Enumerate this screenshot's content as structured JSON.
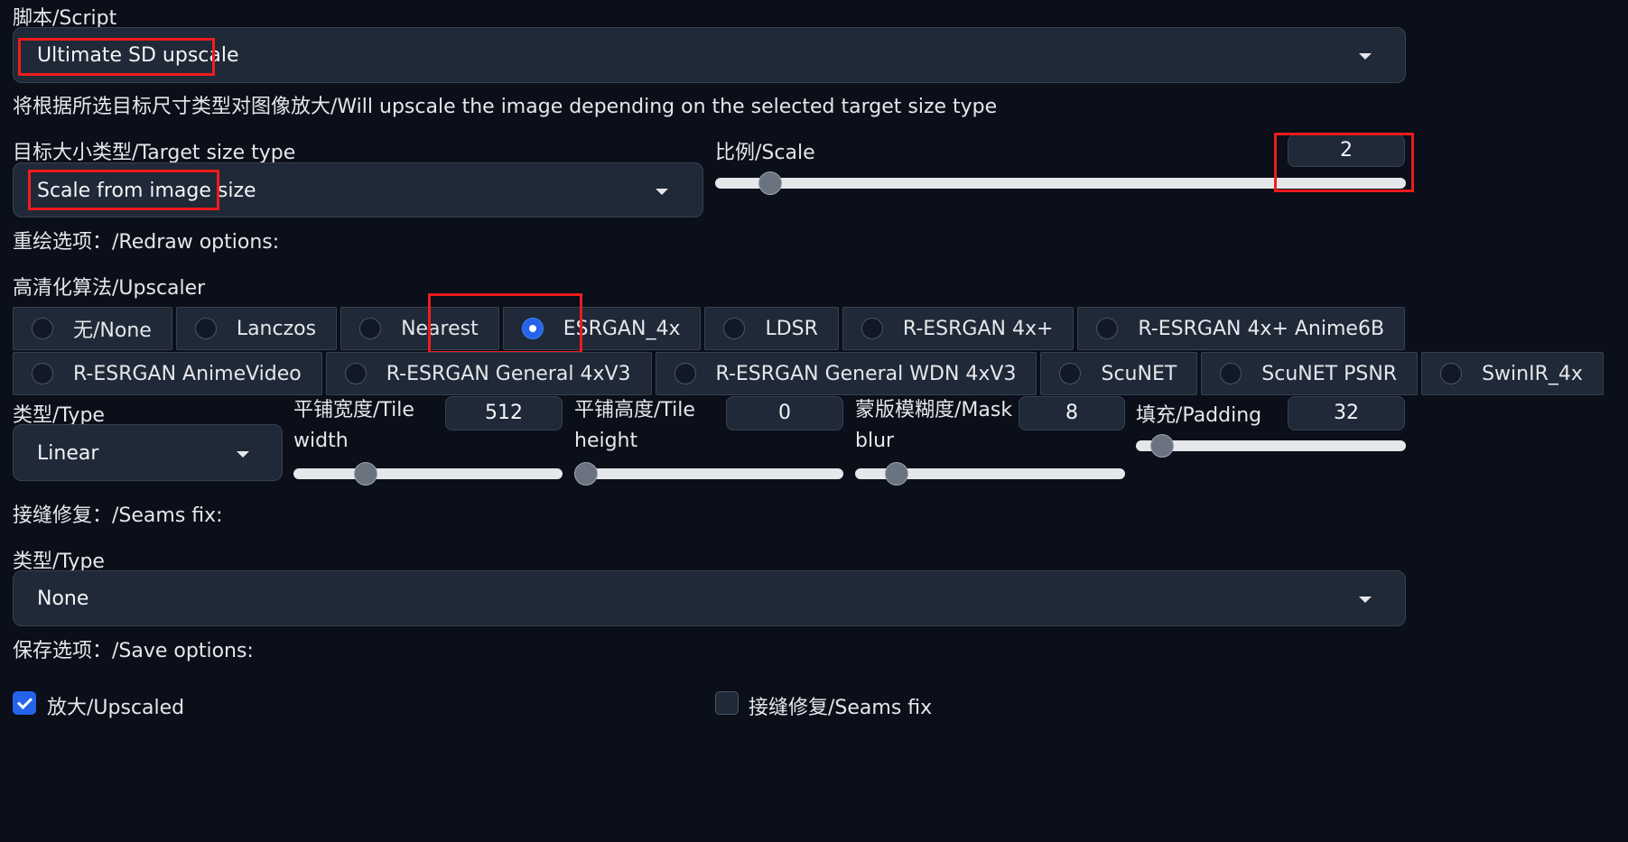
{
  "script": {
    "label": "脚本/Script",
    "value": "Ultimate SD upscale",
    "description": "将根据所选目标尺寸类型对图像放大/Will upscale the image depending on the selected target size type"
  },
  "target_size": {
    "label": "目标大小类型/Target size type",
    "value": "Scale from image size"
  },
  "scale": {
    "label": "比例/Scale",
    "value": "2",
    "slider_fraction": 0.04
  },
  "redraw_options_label": "重绘选项：/Redraw options:",
  "upscaler": {
    "label": "高清化算法/Upscaler",
    "selected": "ESRGAN_4x",
    "row1": [
      "无/None",
      "Lanczos",
      "Nearest",
      "ESRGAN_4x",
      "LDSR",
      "R-ESRGAN 4x+",
      "R-ESRGAN 4x+ Anime6B"
    ],
    "row2": [
      "R-ESRGAN AnimeVideo",
      "R-ESRGAN General 4xV3",
      "R-ESRGAN General WDN 4xV3",
      "ScuNET",
      "ScuNET PSNR",
      "SwinIR_4x"
    ]
  },
  "redraw": {
    "type_label": "类型/Type",
    "type_value": "Linear",
    "tile_width_label": "平铺宽度/Tile width",
    "tile_width_value": "512",
    "tile_height_label": "平铺高度/Tile height",
    "tile_height_value": "0",
    "mask_blur_label": "蒙版模糊度/Mask blur",
    "mask_blur_value": "8",
    "padding_label": "填充/Padding",
    "padding_value": "32"
  },
  "seams_fix": {
    "section_label": "接缝修复：/Seams fix:",
    "type_label": "类型/Type",
    "type_value": "None"
  },
  "save_options": {
    "label": "保存选项：/Save options:",
    "upscaled_label": "放大/Upscaled",
    "upscaled_checked": true,
    "seams_fix_label": "接缝修复/Seams fix",
    "seams_fix_checked": false
  },
  "colors": {
    "background": "#0b0f19",
    "panel": "#1f2937",
    "accent": "#2563eb",
    "highlight_box": "#ef1c1c"
  }
}
